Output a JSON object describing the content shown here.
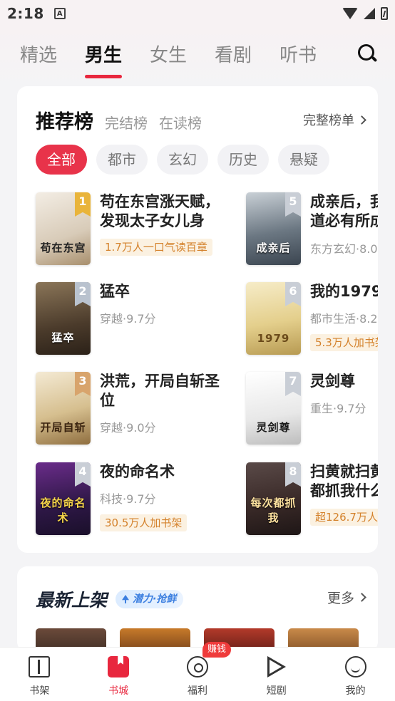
{
  "status": {
    "time": "2:18",
    "notif_icon": "A"
  },
  "tabs": [
    {
      "label": "精选"
    },
    {
      "label": "男生",
      "active": true
    },
    {
      "label": "女生"
    },
    {
      "label": "看剧"
    },
    {
      "label": "听书"
    }
  ],
  "rank": {
    "title": "推荐榜",
    "sub1": "完结榜",
    "sub2": "在读榜",
    "full_list": "完整榜单",
    "chips": [
      "全部",
      "都市",
      "玄幻",
      "历史",
      "悬疑"
    ],
    "books": [
      {
        "rank": "1",
        "title": "苟在东宫涨天赋，\n发现太子女儿身",
        "tag": "1.7万人一口气读百章",
        "cover_text": "苟在东宫",
        "cover_color": "#e9e2d8"
      },
      {
        "rank": "2",
        "title": "猛卒",
        "meta": "穿越·9.7分",
        "cover_text": "猛卒",
        "cover_color": "#5b4a39"
      },
      {
        "rank": "3",
        "title": "洪荒，开局自斩圣\n位",
        "meta": "穿越·9.0分",
        "cover_text": "开局自斩",
        "cover_color": "#e9dcc2"
      },
      {
        "rank": "4",
        "title": "夜的命名术",
        "meta": "科技·9.7分",
        "tag": "30.5万人加书架",
        "cover_text": "夜的命名术",
        "cover_color": "#3b1f54"
      },
      {
        "rank": "5",
        "title": "成亲后，我\n道必有所成",
        "meta": "东方玄幻·8.0",
        "cover_text": "成亲后",
        "cover_color": "#4a5866"
      },
      {
        "rank": "6",
        "title": "我的1979",
        "meta": "都市生活·8.2",
        "tag": "5.3万人加书架",
        "cover_text": "1979",
        "cover_color": "#e8d9a4"
      },
      {
        "rank": "7",
        "title": "灵剑尊",
        "meta": "重生·9.7分",
        "cover_text": "灵剑尊",
        "cover_color": "#f3f3f3"
      },
      {
        "rank": "8",
        "title": "扫黄就扫黄\n都抓我什么",
        "tag": "超126.7万人",
        "cover_text": "每次都抓我",
        "cover_color": "#3a2a28"
      }
    ]
  },
  "latest": {
    "title": "最新上架",
    "badge": "潜力·抢鲜",
    "more": "更多"
  },
  "nav": [
    {
      "label": "书架"
    },
    {
      "label": "书城",
      "active": true
    },
    {
      "label": "福利",
      "badge": "赚钱"
    },
    {
      "label": "短剧"
    },
    {
      "label": "我的"
    }
  ],
  "colors": {
    "accent": "#e8273e",
    "tag_bg": "#fbf1e1",
    "tag_fg": "#d4822c"
  }
}
